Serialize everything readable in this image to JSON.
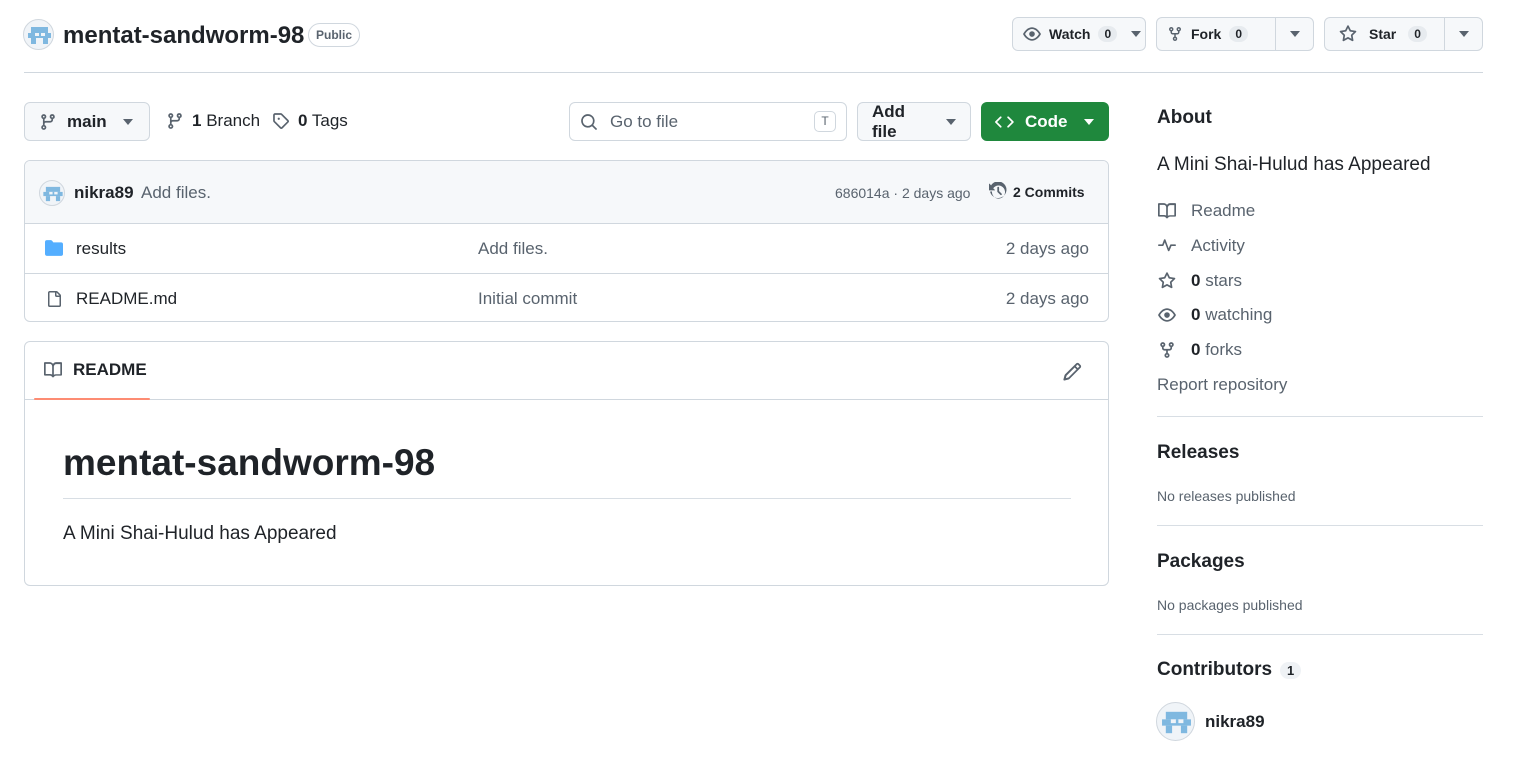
{
  "repo": {
    "name": "mentat-sandworm-98",
    "visibility": "Public"
  },
  "header_actions": {
    "watch": {
      "label": "Watch",
      "count": "0"
    },
    "fork": {
      "label": "Fork",
      "count": "0"
    },
    "star": {
      "label": "Star",
      "count": "0"
    }
  },
  "toolbar": {
    "branch": "main",
    "branches_count": "1",
    "branches_label": "Branch",
    "tags_count": "0",
    "tags_label": "Tags",
    "goto_placeholder": "Go to file",
    "goto_shortcut": "T",
    "add_file_label": "Add file",
    "code_label": "Code"
  },
  "latest_commit": {
    "author": "nikra89",
    "message": "Add files.",
    "hash_time": "686014a · 2 days ago",
    "commits_count_label": "2 Commits"
  },
  "files": [
    {
      "name": "results",
      "type": "folder",
      "message": "Add files.",
      "time": "2 days ago"
    },
    {
      "name": "README.md",
      "type": "file",
      "message": "Initial commit",
      "time": "2 days ago"
    }
  ],
  "readme": {
    "tab_label": "README",
    "heading": "mentat-sandworm-98",
    "body": "A Mini Shai-Hulud has Appeared"
  },
  "sidebar": {
    "about_title": "About",
    "description": "A Mini Shai-Hulud has Appeared",
    "readme_label": "Readme",
    "activity_label": "Activity",
    "stars_count": "0",
    "stars_label": "stars",
    "watching_count": "0",
    "watching_label": "watching",
    "forks_count": "0",
    "forks_label": "forks",
    "report_label": "Report repository",
    "releases_title": "Releases",
    "releases_empty": "No releases published",
    "packages_title": "Packages",
    "packages_empty": "No packages published",
    "contributors_title": "Contributors",
    "contributors_count": "1",
    "contributors": [
      {
        "login": "nikra89"
      }
    ]
  },
  "colors": {
    "code_button": "#1f883d",
    "folder_icon": "#54aeff",
    "tab_underline": "#fd8c73",
    "avatar_blue": "#7fb8e0"
  }
}
